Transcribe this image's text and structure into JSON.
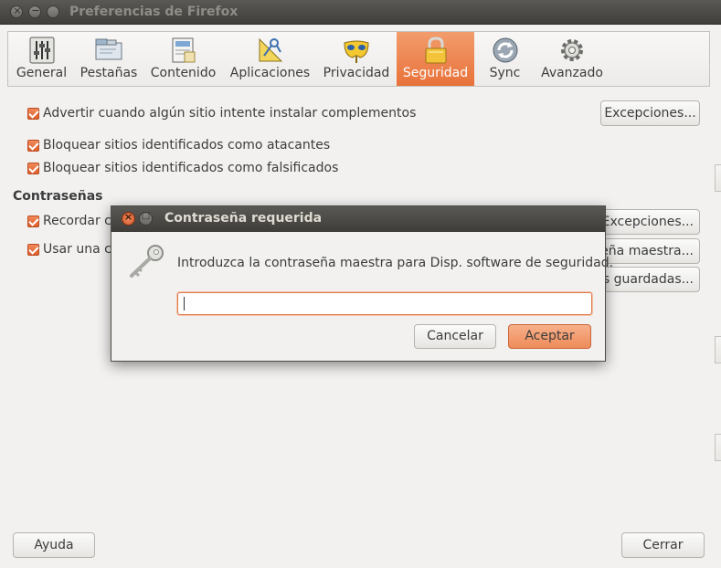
{
  "window": {
    "title": "Preferencias de Firefox",
    "close_glyph": "×",
    "minimize_glyph": "−"
  },
  "tabs": [
    {
      "label": "General",
      "icon": "sliders-icon",
      "active": false
    },
    {
      "label": "Pestañas",
      "icon": "tabs-icon",
      "active": false
    },
    {
      "label": "Contenido",
      "icon": "content-icon",
      "active": false
    },
    {
      "label": "Aplicaciones",
      "icon": "applications-icon",
      "active": false
    },
    {
      "label": "Privacidad",
      "icon": "mask-icon",
      "active": false
    },
    {
      "label": "Seguridad",
      "icon": "lock-icon",
      "active": true
    },
    {
      "label": "Sync",
      "icon": "sync-icon",
      "active": false
    },
    {
      "label": "Avanzado",
      "icon": "gear-icon",
      "active": false
    }
  ],
  "security": {
    "warn_addons": {
      "label": "Advertir cuando algún sitio intente instalar complementos",
      "checked": true
    },
    "exceptions_button": "Excepciones...",
    "block_attack": {
      "label": "Bloquear sitios identificados como atacantes",
      "checked": true
    },
    "block_forgery": {
      "label": "Bloquear sitios identificados como falsificados",
      "checked": true
    }
  },
  "passwords": {
    "section_title": "Contraseñas",
    "remember": {
      "label_visible": "Recordar c",
      "checked": true
    },
    "remember_exceptions_button": "Excepciones...",
    "master": {
      "label_visible": "Usar una co",
      "checked": true
    },
    "master_button_visible": "eña maestra...",
    "saved_button_visible": "s guardadas..."
  },
  "footer": {
    "help_button": "Ayuda",
    "close_button": "Cerrar"
  },
  "dialog": {
    "title": "Contraseña requerida",
    "close_glyph": "×",
    "maximize_glyph": "□",
    "message": "Introduzca la contraseña maestra para Disp. software de seguridad.",
    "password_value": "",
    "cancel_button": "Cancelar",
    "accept_button": "Aceptar"
  },
  "colors": {
    "accent": "#e8723a",
    "window_bg": "#f2f1f0",
    "titlebar": "#403f3b"
  }
}
